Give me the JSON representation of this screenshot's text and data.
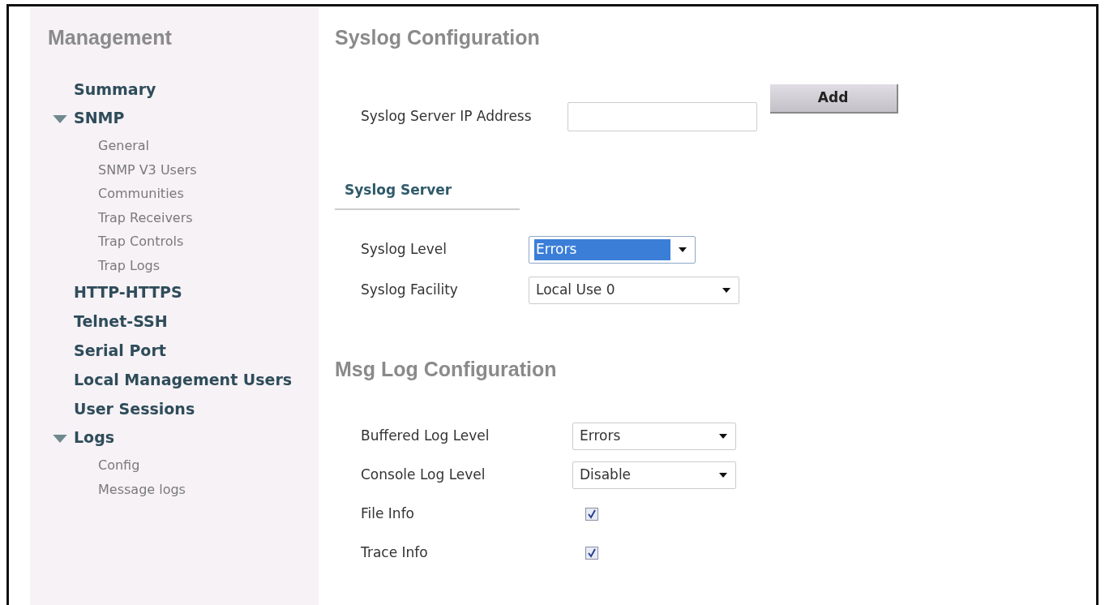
{
  "sidebar": {
    "title": "Management",
    "items": [
      {
        "kind": "link",
        "label": "Summary"
      },
      {
        "kind": "group",
        "label": "SNMP",
        "expanded": true,
        "children": [
          {
            "label": "General"
          },
          {
            "label": "SNMP V3 Users"
          },
          {
            "label": "Communities"
          },
          {
            "label": "Trap Receivers"
          },
          {
            "label": "Trap Controls"
          },
          {
            "label": "Trap Logs"
          }
        ]
      },
      {
        "kind": "link",
        "label": "HTTP-HTTPS"
      },
      {
        "kind": "link",
        "label": "Telnet-SSH"
      },
      {
        "kind": "link",
        "label": "Serial Port"
      },
      {
        "kind": "link",
        "label": "Local Management Users"
      },
      {
        "kind": "link",
        "label": "User Sessions"
      },
      {
        "kind": "group",
        "label": "Logs",
        "expanded": true,
        "children": [
          {
            "label": "Config"
          },
          {
            "label": "Message logs"
          }
        ]
      }
    ]
  },
  "syslog": {
    "title": "Syslog Configuration",
    "ip_label": "Syslog Server IP Address",
    "add_button": "Add",
    "section_tab": "Syslog Server",
    "fields": [
      {
        "label": "Syslog Level",
        "value": "Errors",
        "focused": true
      },
      {
        "label": "Syslog Facility",
        "value": "Local Use 0",
        "focused": false
      }
    ]
  },
  "msg_log": {
    "title": "Msg Log Configuration",
    "fields": [
      {
        "kind": "select",
        "label": "Buffered Log Level",
        "value": "Errors"
      },
      {
        "kind": "select",
        "label": "Console Log Level",
        "value": "Disable"
      },
      {
        "kind": "checkbox",
        "label": "File Info",
        "checked": true
      },
      {
        "kind": "checkbox",
        "label": "Trace Info",
        "checked": true
      }
    ]
  }
}
